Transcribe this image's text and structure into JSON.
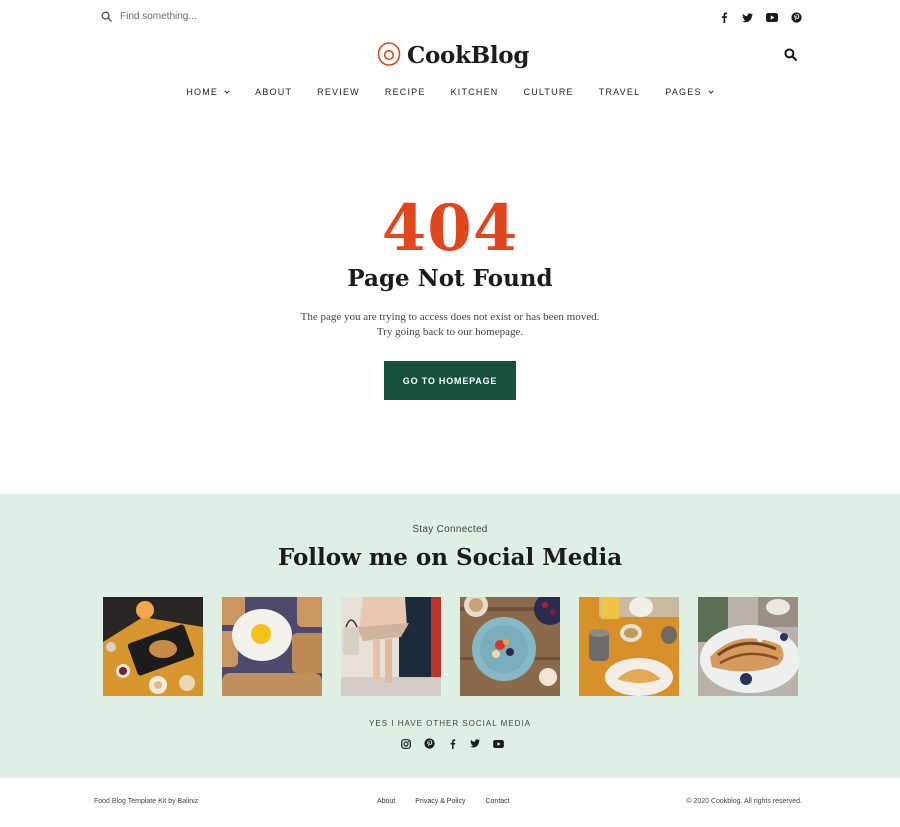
{
  "topbar": {
    "search_placeholder": "Find something...",
    "social_icons": [
      "facebook-icon",
      "twitter-icon",
      "youtube-icon",
      "pinterest-icon"
    ]
  },
  "header": {
    "brand": "CookBlog",
    "accent_color": "#e0471f"
  },
  "nav": {
    "items": [
      {
        "label": "HOME",
        "has_dropdown": true
      },
      {
        "label": "ABOUT",
        "has_dropdown": false
      },
      {
        "label": "REVIEW",
        "has_dropdown": false
      },
      {
        "label": "RECIPE",
        "has_dropdown": false
      },
      {
        "label": "KITCHEN",
        "has_dropdown": false
      },
      {
        "label": "CULTURE",
        "has_dropdown": false
      },
      {
        "label": "TRAVEL",
        "has_dropdown": false
      },
      {
        "label": "PAGES",
        "has_dropdown": true
      }
    ]
  },
  "error": {
    "code": "404",
    "title": "Page Not Found",
    "message_line1": "The page you are trying to access does not exist or has been moved.",
    "message_line2": "Try going back to our homepage.",
    "button_label": "GO TO HOMEPAGE",
    "button_color": "#17503f"
  },
  "social": {
    "eyebrow": "Stay Connected",
    "heading": "Follow me on Social Media",
    "gallery": [
      "breakfast-tray-photo",
      "fried-egg-toast-photo",
      "fashion-legs-photo",
      "fruit-bowl-photo",
      "croissant-coffee-photo",
      "crepes-plate-photo"
    ],
    "subheading": "YES I HAVE OTHER SOCIAL MEDIA",
    "icons": [
      "instagram-icon",
      "pinterest-icon",
      "facebook-icon",
      "twitter-icon",
      "youtube-icon"
    ],
    "background": "#dfefe4"
  },
  "footer": {
    "left": "Food Blog Template Kit by Baliniz",
    "links": [
      "About",
      "Privacy & Policy",
      "Contact"
    ],
    "right": "© 2020 Cookblog. All rights reserved."
  }
}
